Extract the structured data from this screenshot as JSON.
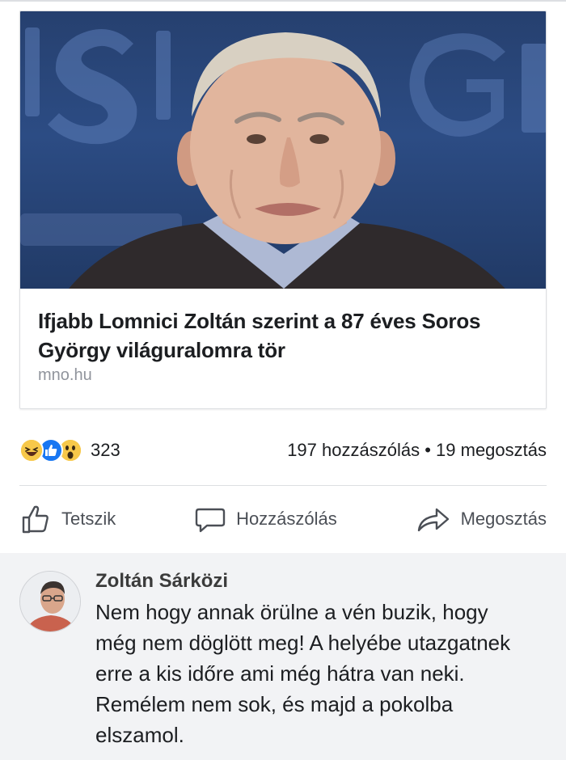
{
  "link_preview": {
    "title": "Ifjabb Lomnici Zoltán szerint a 87 éves Soros György világuralomra tör",
    "domain": "mno.hu",
    "image_icon": "portrait-photo"
  },
  "stats": {
    "reaction_icons": [
      "haha-icon",
      "like-icon",
      "wow-icon"
    ],
    "reaction_count": "323",
    "comments_count": "197 hozzászólás",
    "separator": "•",
    "shares_count": "19 megosztás"
  },
  "actions": {
    "like_label": "Tetszik",
    "comment_label": "Hozzászólás",
    "share_label": "Megosztás"
  },
  "comment": {
    "author": "Zoltán Sárközi",
    "text": "Nem hogy annak örülne a vén buzik, hogy még nem döglött meg! A helyébe utazgatnek erre a kis időre ami még hátra van neki. Remélem nem sok, és majd a pokolba elszamol."
  },
  "colors": {
    "like_blue": "#1877f2",
    "reaction_yellow": "#f7c84a",
    "comment_bg": "#f2f3f5",
    "muted_text": "#90949c"
  }
}
